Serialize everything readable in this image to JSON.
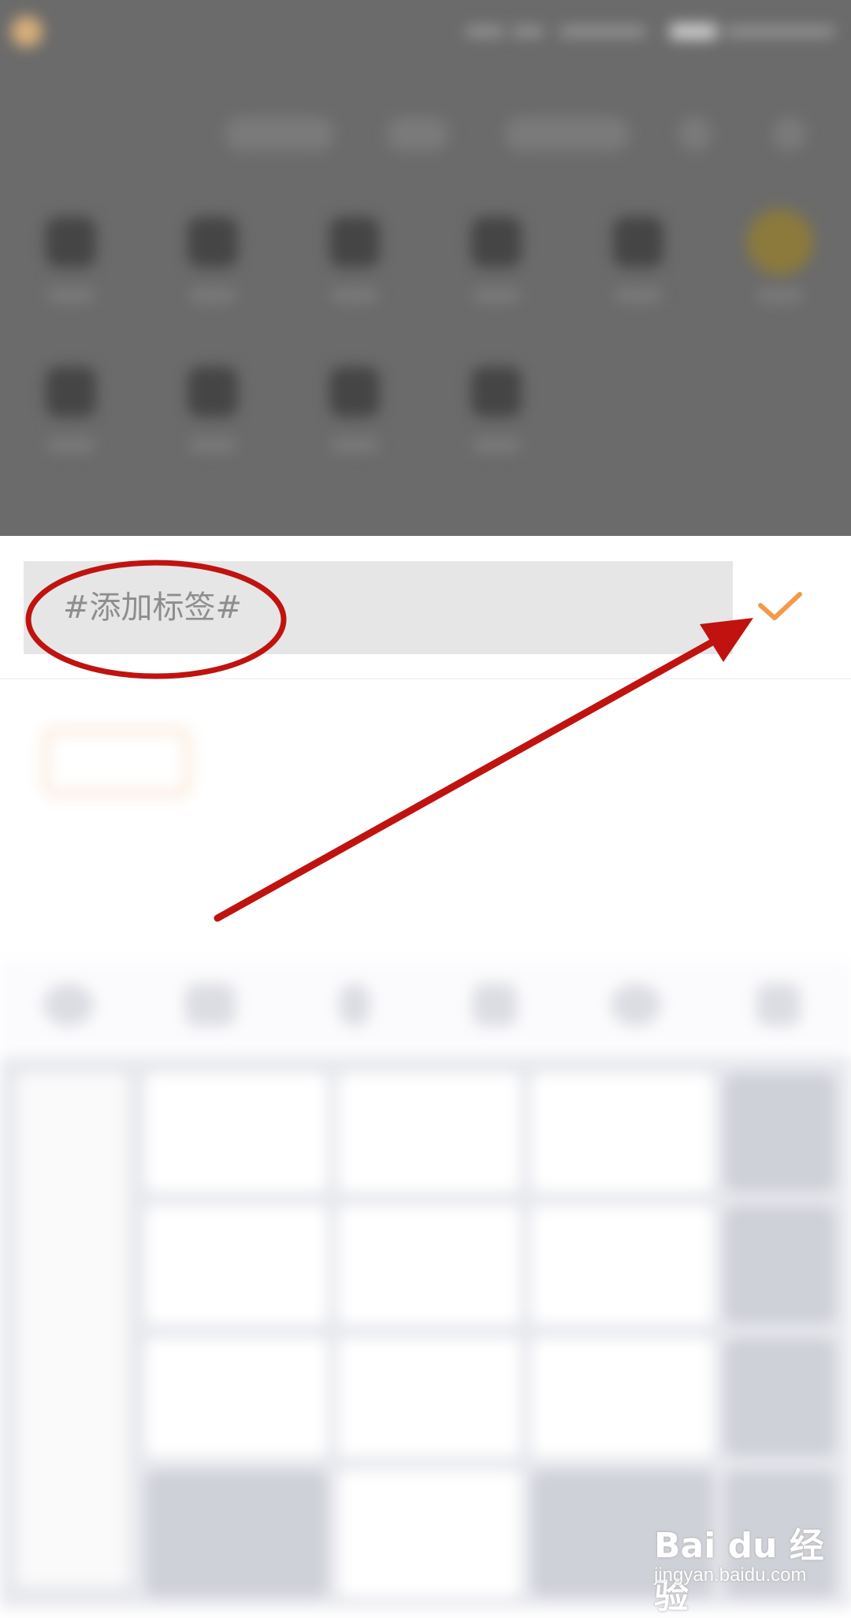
{
  "tag_input": {
    "placeholder": "#添加标签#"
  },
  "confirm_icon": "checkmark-icon",
  "colors": {
    "accent": "#f29a4a",
    "annotation": "#c0130f",
    "dim_overlay": "#6b6b6b"
  },
  "watermark": {
    "logo": "Bai du 经验",
    "url": "jingyan.baidu.com"
  }
}
